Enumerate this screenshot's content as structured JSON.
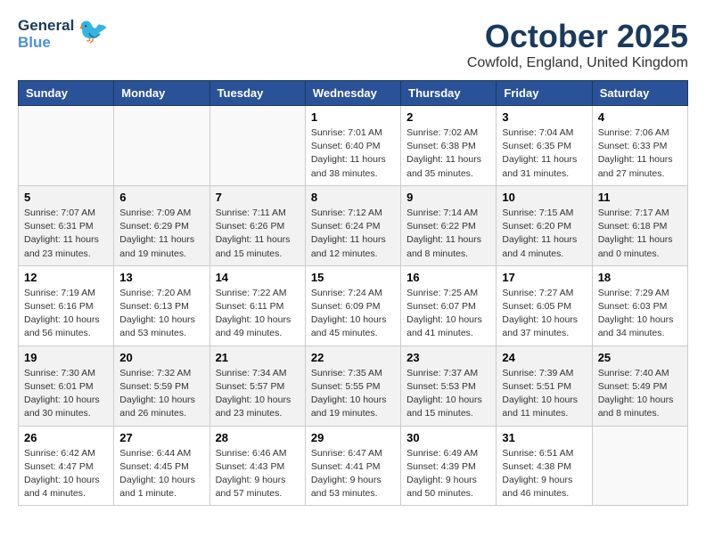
{
  "header": {
    "logo_line1": "General",
    "logo_line2": "Blue",
    "month": "October 2025",
    "location": "Cowfold, England, United Kingdom"
  },
  "days_of_week": [
    "Sunday",
    "Monday",
    "Tuesday",
    "Wednesday",
    "Thursday",
    "Friday",
    "Saturday"
  ],
  "weeks": [
    [
      {
        "day": "",
        "info": ""
      },
      {
        "day": "",
        "info": ""
      },
      {
        "day": "",
        "info": ""
      },
      {
        "day": "1",
        "info": "Sunrise: 7:01 AM\nSunset: 6:40 PM\nDaylight: 11 hours\nand 38 minutes."
      },
      {
        "day": "2",
        "info": "Sunrise: 7:02 AM\nSunset: 6:38 PM\nDaylight: 11 hours\nand 35 minutes."
      },
      {
        "day": "3",
        "info": "Sunrise: 7:04 AM\nSunset: 6:35 PM\nDaylight: 11 hours\nand 31 minutes."
      },
      {
        "day": "4",
        "info": "Sunrise: 7:06 AM\nSunset: 6:33 PM\nDaylight: 11 hours\nand 27 minutes."
      }
    ],
    [
      {
        "day": "5",
        "info": "Sunrise: 7:07 AM\nSunset: 6:31 PM\nDaylight: 11 hours\nand 23 minutes."
      },
      {
        "day": "6",
        "info": "Sunrise: 7:09 AM\nSunset: 6:29 PM\nDaylight: 11 hours\nand 19 minutes."
      },
      {
        "day": "7",
        "info": "Sunrise: 7:11 AM\nSunset: 6:26 PM\nDaylight: 11 hours\nand 15 minutes."
      },
      {
        "day": "8",
        "info": "Sunrise: 7:12 AM\nSunset: 6:24 PM\nDaylight: 11 hours\nand 12 minutes."
      },
      {
        "day": "9",
        "info": "Sunrise: 7:14 AM\nSunset: 6:22 PM\nDaylight: 11 hours\nand 8 minutes."
      },
      {
        "day": "10",
        "info": "Sunrise: 7:15 AM\nSunset: 6:20 PM\nDaylight: 11 hours\nand 4 minutes."
      },
      {
        "day": "11",
        "info": "Sunrise: 7:17 AM\nSunset: 6:18 PM\nDaylight: 11 hours\nand 0 minutes."
      }
    ],
    [
      {
        "day": "12",
        "info": "Sunrise: 7:19 AM\nSunset: 6:16 PM\nDaylight: 10 hours\nand 56 minutes."
      },
      {
        "day": "13",
        "info": "Sunrise: 7:20 AM\nSunset: 6:13 PM\nDaylight: 10 hours\nand 53 minutes."
      },
      {
        "day": "14",
        "info": "Sunrise: 7:22 AM\nSunset: 6:11 PM\nDaylight: 10 hours\nand 49 minutes."
      },
      {
        "day": "15",
        "info": "Sunrise: 7:24 AM\nSunset: 6:09 PM\nDaylight: 10 hours\nand 45 minutes."
      },
      {
        "day": "16",
        "info": "Sunrise: 7:25 AM\nSunset: 6:07 PM\nDaylight: 10 hours\nand 41 minutes."
      },
      {
        "day": "17",
        "info": "Sunrise: 7:27 AM\nSunset: 6:05 PM\nDaylight: 10 hours\nand 37 minutes."
      },
      {
        "day": "18",
        "info": "Sunrise: 7:29 AM\nSunset: 6:03 PM\nDaylight: 10 hours\nand 34 minutes."
      }
    ],
    [
      {
        "day": "19",
        "info": "Sunrise: 7:30 AM\nSunset: 6:01 PM\nDaylight: 10 hours\nand 30 minutes."
      },
      {
        "day": "20",
        "info": "Sunrise: 7:32 AM\nSunset: 5:59 PM\nDaylight: 10 hours\nand 26 minutes."
      },
      {
        "day": "21",
        "info": "Sunrise: 7:34 AM\nSunset: 5:57 PM\nDaylight: 10 hours\nand 23 minutes."
      },
      {
        "day": "22",
        "info": "Sunrise: 7:35 AM\nSunset: 5:55 PM\nDaylight: 10 hours\nand 19 minutes."
      },
      {
        "day": "23",
        "info": "Sunrise: 7:37 AM\nSunset: 5:53 PM\nDaylight: 10 hours\nand 15 minutes."
      },
      {
        "day": "24",
        "info": "Sunrise: 7:39 AM\nSunset: 5:51 PM\nDaylight: 10 hours\nand 11 minutes."
      },
      {
        "day": "25",
        "info": "Sunrise: 7:40 AM\nSunset: 5:49 PM\nDaylight: 10 hours\nand 8 minutes."
      }
    ],
    [
      {
        "day": "26",
        "info": "Sunrise: 6:42 AM\nSunset: 4:47 PM\nDaylight: 10 hours\nand 4 minutes."
      },
      {
        "day": "27",
        "info": "Sunrise: 6:44 AM\nSunset: 4:45 PM\nDaylight: 10 hours\nand 1 minute."
      },
      {
        "day": "28",
        "info": "Sunrise: 6:46 AM\nSunset: 4:43 PM\nDaylight: 9 hours\nand 57 minutes."
      },
      {
        "day": "29",
        "info": "Sunrise: 6:47 AM\nSunset: 4:41 PM\nDaylight: 9 hours\nand 53 minutes."
      },
      {
        "day": "30",
        "info": "Sunrise: 6:49 AM\nSunset: 4:39 PM\nDaylight: 9 hours\nand 50 minutes."
      },
      {
        "day": "31",
        "info": "Sunrise: 6:51 AM\nSunset: 4:38 PM\nDaylight: 9 hours\nand 46 minutes."
      },
      {
        "day": "",
        "info": ""
      }
    ]
  ]
}
